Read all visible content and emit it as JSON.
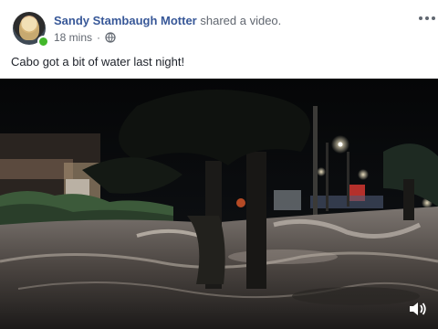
{
  "post": {
    "author": "Sandy Stambaugh Motter",
    "action": "shared a video.",
    "time": "18 mins",
    "separator": "·",
    "text": "Cabo got a bit of water last night!"
  },
  "icons": {
    "privacy": "globe-icon",
    "menu": "more-options-icon",
    "audio": "volume-icon"
  },
  "colors": {
    "author_link": "#385898",
    "online": "#42b72a",
    "meta_text": "#616770"
  }
}
